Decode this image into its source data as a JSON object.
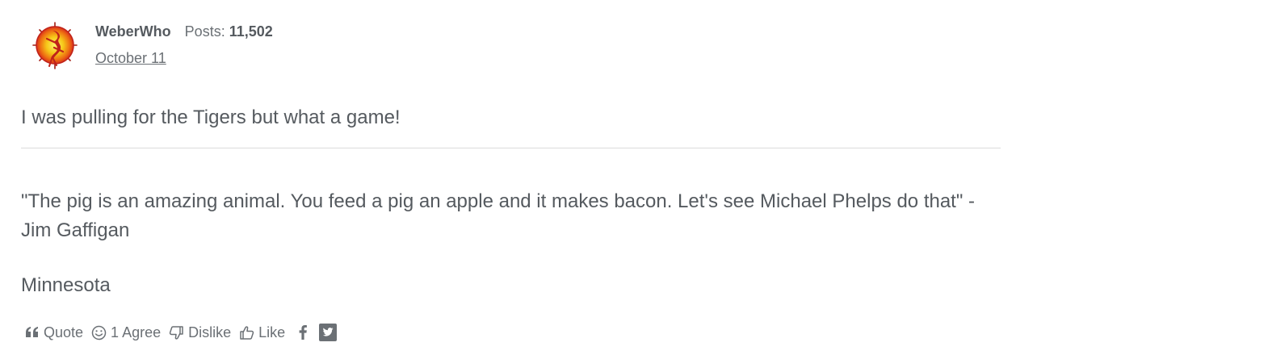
{
  "post": {
    "author": {
      "name": "WeberWho",
      "posts_label": "Posts:",
      "posts_count": "11,502",
      "date": "October 11",
      "avatar_icon": "dancing-flame-logo-icon"
    },
    "body": "I was pulling for the Tigers but what a game!",
    "signature": {
      "quote": "\"The pig is an amazing animal. You feed a pig an apple and it makes bacon. Let's see Michael Phelps do that\" - Jim Gaffigan",
      "location": "Minnesota"
    },
    "reactions": {
      "quote_label": "Quote",
      "agree_label": "1 Agree",
      "dislike_label": "Dislike",
      "like_label": "Like",
      "share_icons": [
        "facebook-icon",
        "twitter-icon"
      ]
    }
  },
  "colors": {
    "text": "#555a5f",
    "muted": "#6b7075",
    "divider": "#dcdcdc",
    "avatar_red": "#d9301c",
    "avatar_yellow": "#f6d21a"
  }
}
